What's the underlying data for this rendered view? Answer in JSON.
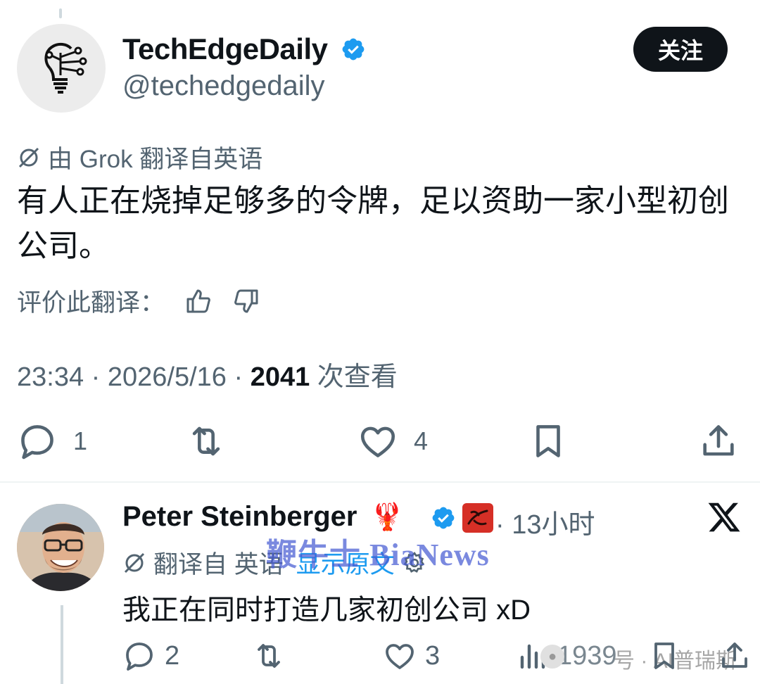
{
  "colors": {
    "text": "#0f1419",
    "muted": "#536471",
    "verified": "#1d9bf0",
    "link": "#1d9bf0",
    "watermark": "#465cd2"
  },
  "tweet": {
    "name": "TechEdgeDaily",
    "handle": "@techedgedaily",
    "follow_label": "关注",
    "translation_note": "由 Grok 翻译自英语",
    "text": "有人正在烧掉足够多的令牌，足以资助一家小型初创公司。",
    "rate_label": "评价此翻译：",
    "time": "23:34 · 2026/5/16 · ",
    "views": "2041",
    "views_label": " 次查看",
    "stats": {
      "replies": "1",
      "likes": "4"
    },
    "icons": [
      "lightbulb-circuit-icon",
      "verified-icon",
      "translate-icon",
      "thumbs-up-icon",
      "thumbs-down-icon",
      "reply-icon",
      "retweet-icon",
      "like-icon",
      "bookmark-icon",
      "share-icon"
    ]
  },
  "reply": {
    "name": "Peter Steinberger",
    "emoji": "🦞",
    "time": "· 13小时",
    "translation_prefix": "翻译自 英语",
    "show_original": "显示原文",
    "text": "我正在同时打造几家初创公司 xD",
    "stats": {
      "replies": "2",
      "likes": "3",
      "views": "1939"
    },
    "icons": [
      "lobster-icon",
      "verified-icon",
      "lobster-badge-icon",
      "x-logo-icon",
      "translate-icon",
      "gear-icon",
      "reply-icon",
      "retweet-icon",
      "like-icon",
      "views-icon",
      "bookmark-icon",
      "share-icon"
    ]
  },
  "watermark": {
    "text": "鞭牛士 BiaNews",
    "wechat": "号 · AI普瑞斯"
  }
}
